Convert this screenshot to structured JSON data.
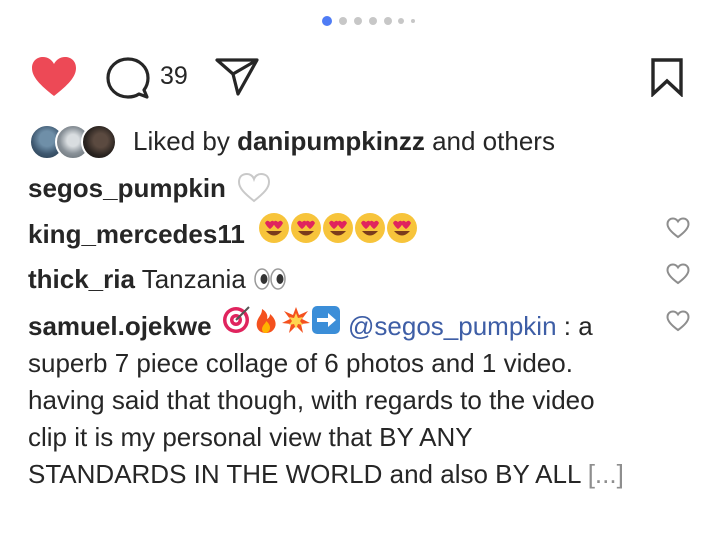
{
  "carousel": {
    "dot_count": 6,
    "active_index": 0
  },
  "actions": {
    "comment_count": "39",
    "like_icon": "heart-filled-icon",
    "comment_icon": "comment-icon",
    "share_icon": "send-icon",
    "save_icon": "bookmark-icon",
    "like_color": "#ed4956"
  },
  "likes": {
    "prefix": "Liked by ",
    "user": "danipumpkinzz",
    "suffix": " and others"
  },
  "caption": {
    "user": "segos_pumpkin",
    "emoji": "white-heart"
  },
  "comments": [
    {
      "user": "king_mercedes11",
      "text": "",
      "emoji": "heart-eyes x5"
    },
    {
      "user": "thick_ria",
      "text": " Tanzania ",
      "emoji": "eyes"
    },
    {
      "user": "samuel.ojekwe",
      "emoji": "target, fire, collision, right-arrow",
      "mention": "@segos_pumpkin",
      "line1_tail": " : a",
      "line2": "superb 7 piece collage of 6 photos and 1 video.",
      "line3": "having said that though, with regards to the video",
      "line4": "clip it is my personal view that BY ANY",
      "line5": "STANDARDS IN THE WORLD and also BY ALL ",
      "more": "[...]"
    }
  ]
}
